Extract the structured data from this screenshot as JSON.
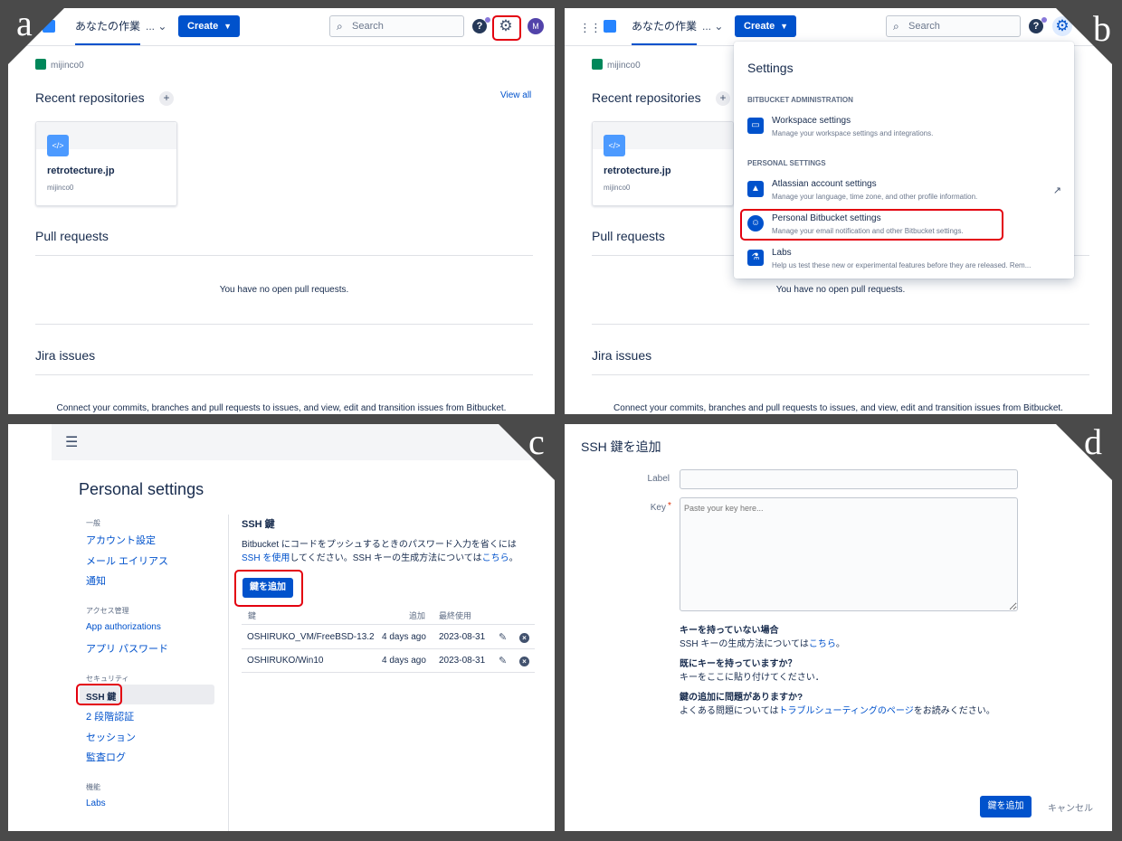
{
  "panel_letters": {
    "a": "a",
    "b": "b",
    "c": "c",
    "d": "d"
  },
  "dashboard": {
    "nav_work": "あなたの作業",
    "nav_more": "... ⌄",
    "create_label": "Create",
    "search_placeholder": "Search",
    "help": "?",
    "avatar_initial": "M",
    "workspace": "mijinco0",
    "recent_repos_title": "Recent repositories",
    "view_all": "View all",
    "repo_name": "retrotecture.jp",
    "repo_owner": "mijinco0",
    "repo_icon": "</>",
    "pull_requests_title": "Pull requests",
    "no_prs": "You have no open pull requests.",
    "jira_title": "Jira issues",
    "jira_text": "Connect your commits, branches and pull requests to issues, and view, edit and transition issues from Bitbucket."
  },
  "settings_menu": {
    "title": "Settings",
    "section_admin": "BITBUCKET ADMINISTRATION",
    "workspace_title": "Workspace settings",
    "workspace_desc": "Manage your workspace settings and integrations.",
    "section_personal": "PERSONAL SETTINGS",
    "atlassian_title": "Atlassian account settings",
    "atlassian_desc": "Manage your language, time zone, and other profile information.",
    "personal_title": "Personal Bitbucket settings",
    "personal_desc": "Manage your email notification and other Bitbucket settings.",
    "labs_title": "Labs",
    "labs_desc": "Help us test these new or experimental features before they are released. Rem..."
  },
  "personal_settings": {
    "title": "Personal settings",
    "nav": {
      "general": "一般",
      "account": "アカウント設定",
      "email_alias": "メール エイリアス",
      "notifications": "通知",
      "access": "アクセス管理",
      "app_auth": "App authorizations",
      "app_password": "アプリ パスワード",
      "security": "セキュリティ",
      "ssh_keys": "SSH 鍵",
      "two_step": "2 段階認証",
      "sessions": "セッション",
      "audit_log": "監査ログ",
      "features": "機能",
      "labs": "Labs"
    },
    "ssh_heading": "SSH 鍵",
    "desc_1": "Bitbucket にコードをプッシュするときのパスワード入力を省くには",
    "desc_link_1": "SSH を使用",
    "desc_2": "してください。SSH キーの生成方法については",
    "desc_link_2": "こちら",
    "desc_3": "。",
    "add_key_btn": "鍵を追加",
    "columns": {
      "key": "鍵",
      "added": "追加",
      "last_used": "最終使用"
    },
    "rows": [
      {
        "key": "OSHIRUKO_VM/FreeBSD-13.2",
        "added": "4 days ago",
        "last_used": "2023-08-31"
      },
      {
        "key": "OSHIRUKO/Win10",
        "added": "4 days ago",
        "last_used": "2023-08-31"
      }
    ]
  },
  "add_ssh": {
    "title": "SSH 鍵を追加",
    "label_label": "Label",
    "key_label": "Key",
    "required_mark": "*",
    "key_placeholder": "Paste your key here...",
    "no_key_h": "キーを持っていない場合",
    "no_key_t1": "SSH キーの生成方法については",
    "no_key_link": "こちら",
    "no_key_t2": "。",
    "have_key_h": "既にキーを持っていますか？",
    "have_key_t": "キーをここに貼り付けてください．",
    "problem_h": "鍵の追加に問題がありますか?",
    "problem_t1": "よくある問題については",
    "problem_link": "トラブルシューティングのページ",
    "problem_t2": "をお読みください。",
    "submit": "鍵を追加",
    "cancel": "キャンセル"
  },
  "colors": {
    "primary": "#0052cc",
    "highlight": "#e3000f",
    "background": "#4a4a4a"
  }
}
